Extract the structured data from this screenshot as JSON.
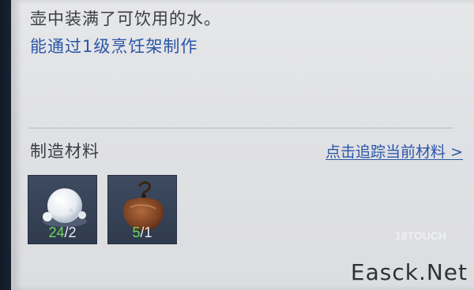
{
  "item": {
    "description": "壶中装满了可饮用的水。",
    "craft_requirement": "能通过1级烹饪架制作"
  },
  "materials": {
    "title": "制造材料",
    "track_link": "点击追踪当前材料 >",
    "items": [
      {
        "icon": "snowball-icon",
        "have": "24",
        "sep": "/",
        "need": "2"
      },
      {
        "icon": "leather-pouch-icon",
        "have": "5",
        "sep": "/",
        "need": "1"
      }
    ]
  },
  "watermark": {
    "logo": "18TOUCH",
    "site": "Easck.Net"
  },
  "colors": {
    "paper": "#e2e3e6",
    "link": "#2a56a6",
    "have_count": "#6fd85a",
    "slot": "#3a465a"
  }
}
